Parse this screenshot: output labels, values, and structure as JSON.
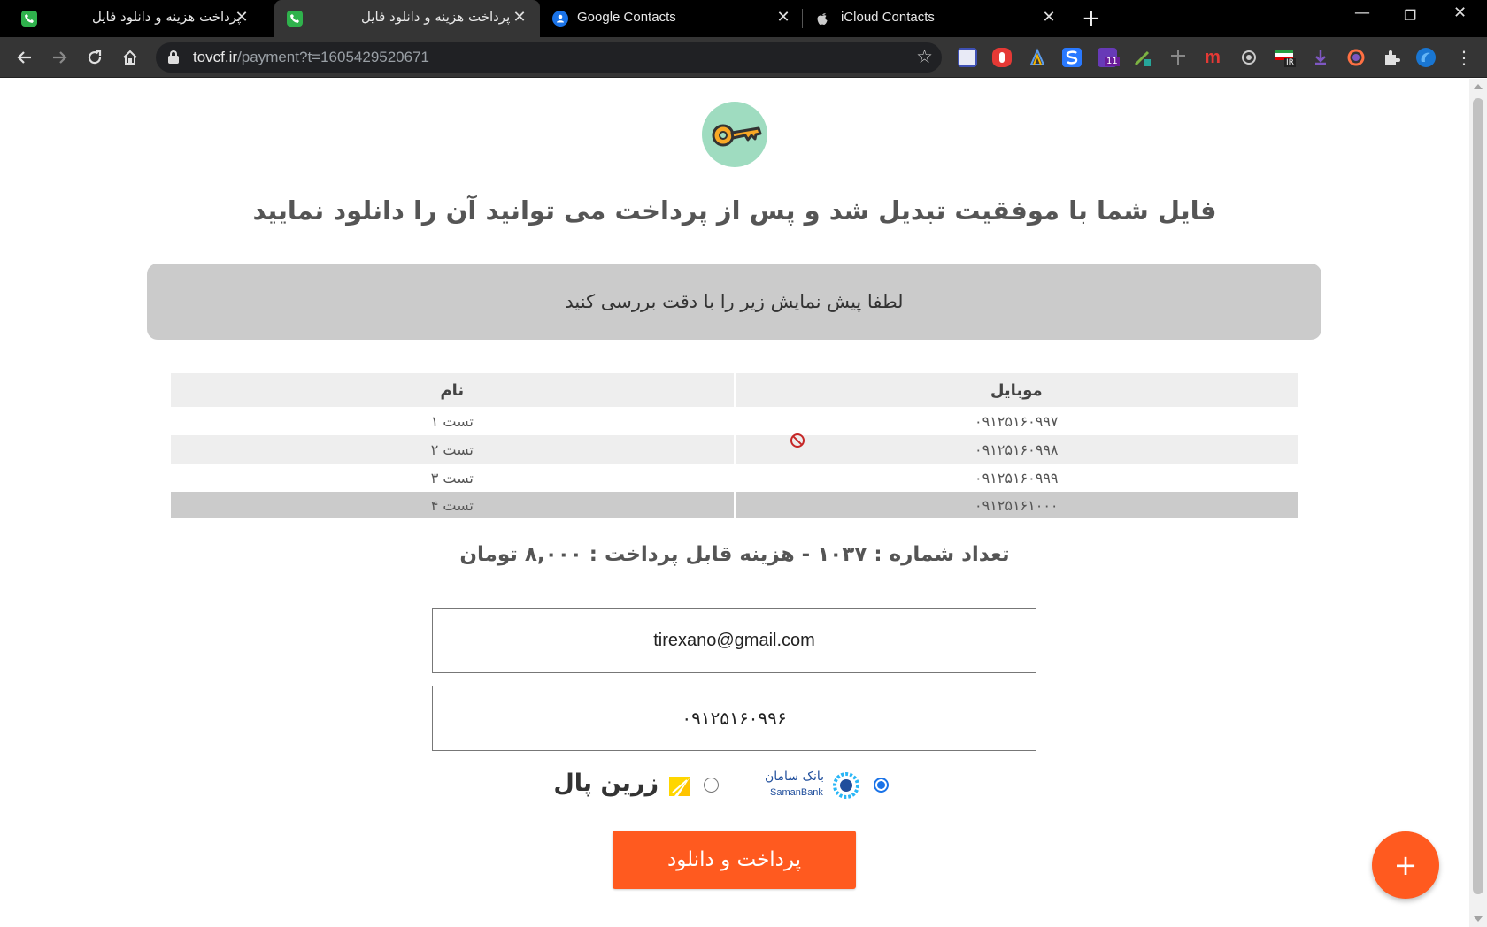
{
  "browser": {
    "tabs": [
      {
        "title": "پرداخت هزینه و دانلود فایل",
        "active": false
      },
      {
        "title": "پرداخت هزینه و دانلود فایل",
        "active": true
      },
      {
        "title": "Google Contacts",
        "active": false
      },
      {
        "title": "iCloud Contacts",
        "active": false
      }
    ],
    "url_host": "tovcf.ir",
    "url_path": "/payment?t=1605429520671",
    "ext_badge_count": "11",
    "ext_badge_ir": "IR"
  },
  "page": {
    "headline": "فایل شما با موفقیت تبدیل شد و پس از پرداخت می توانید آن را دانلود نمایید",
    "notice": "لطفا پیش نمایش زیر را با دقت بررسی کنید",
    "table": {
      "headers": {
        "mobile": "موبایل",
        "name": "نام"
      },
      "rows": [
        {
          "mobile": "۰۹۱۲۵۱۶۰۹۹۷",
          "name": "تست ۱"
        },
        {
          "mobile": "۰۹۱۲۵۱۶۰۹۹۸",
          "name": "تست ۲"
        },
        {
          "mobile": "۰۹۱۲۵۱۶۰۹۹۹",
          "name": "تست ۳"
        },
        {
          "mobile": "۰۹۱۲۵۱۶۱۰۰۰",
          "name": "تست ۴"
        }
      ]
    },
    "summary": "تعداد شماره : ۱۰۳۷ - هزینه قابل پرداخت : ۸,۰۰۰ تومان",
    "email_value": "tirexano@gmail.com",
    "phone_value": "۰۹۱۲۵۱۶۰۹۹۶",
    "gateways": {
      "saman_label_fa": "بانک سامان",
      "saman_label_en": "SamanBank",
      "zarin_label": "زرین پال",
      "selected": "saman"
    },
    "pay_button": "پرداخت و دانلود",
    "fab_label": "+"
  }
}
